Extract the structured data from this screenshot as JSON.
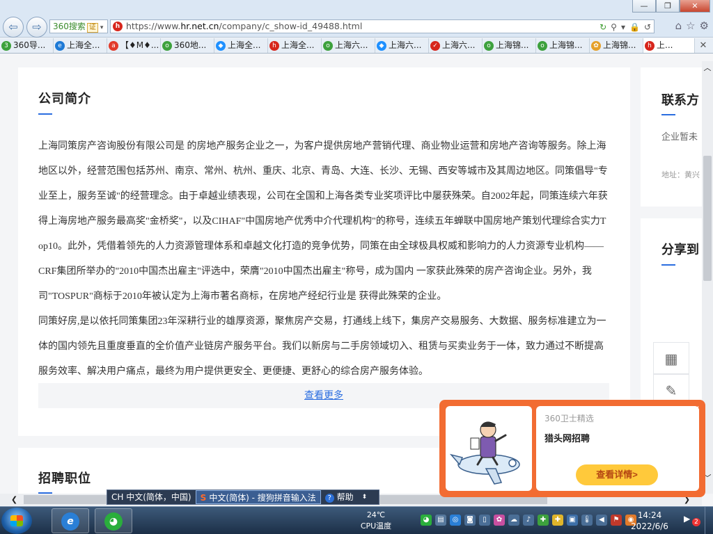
{
  "browser": {
    "back_icon": "back-arrow-icon",
    "forward_icon": "forward-arrow-icon",
    "search_engine": {
      "label": "360搜索",
      "badge": "证"
    },
    "url_prefix": "https://www.",
    "url_host": "hr.net.cn",
    "url_path": "/company/c_show-id_49488.html",
    "addr_tools": [
      "↻",
      "⚲",
      "▾",
      "🔒",
      "↺"
    ],
    "toolbar_icons": [
      "⌂",
      "☆",
      "⚙"
    ],
    "window_buttons": [
      "—",
      "❐",
      "✕"
    ]
  },
  "tabs": [
    {
      "label": "360导...",
      "icon_color": "#3da13d",
      "icon": "3"
    },
    {
      "label": "上海全...",
      "icon_color": "#1e7ad6",
      "icon": "e"
    },
    {
      "label": "【♦M♦...",
      "icon_color": "#e23b2b",
      "icon": "a"
    },
    {
      "label": "360地...",
      "icon_color": "#3da13d",
      "icon": "o"
    },
    {
      "label": "上海全...",
      "icon_color": "#1e90ff",
      "icon": "◆"
    },
    {
      "label": "上海全...",
      "icon_color": "#d7261c",
      "icon": "h"
    },
    {
      "label": "上海六...",
      "icon_color": "#3da13d",
      "icon": "o"
    },
    {
      "label": "上海六...",
      "icon_color": "#1e90ff",
      "icon": "◆"
    },
    {
      "label": "上海六...",
      "icon_color": "#d7261c",
      "icon": "✓"
    },
    {
      "label": "上海锦...",
      "icon_color": "#3da13d",
      "icon": "o"
    },
    {
      "label": "上海锦...",
      "icon_color": "#3da13d",
      "icon": "o"
    },
    {
      "label": "上海锦...",
      "icon_color": "#e5a02a",
      "icon": "✿"
    },
    {
      "label": "上...",
      "icon_color": "#d7261c",
      "icon": "h",
      "active": true
    }
  ],
  "tab_close": "✕",
  "intro": {
    "title": "公司简介",
    "paragraphs": [
      "上海同策房产咨询股份有限公司是 的房地产服务企业之一，为客户提供房地产营销代理、商业物业运营和房地产咨询等服务。除上海地区以外，经营范围包括苏州、南京、常州、杭州、重庆、北京、青岛、大连、长沙、无锡、西安等城市及其周边地区。同策倡导\"专业至上，服务至诚\"的经营理念。由于卓越业绩表现，公司在全国和上海各类专业奖项评比中屡获殊荣。自2002年起，同策连续六年获得上海房地产服务最高奖\"金桥奖\"，以及CIHAF\"中国房地产优秀中介代理机构\"的称号，连续五年蝉联中国房地产策划代理综合实力Top10。此外，凭借着领先的人力资源管理体系和卓越文化打造的竞争优势，同策在由全球极具权威和影响力的人力资源专业机构——CRF集团所举办的\"2010中国杰出雇主\"评选中，荣膺\"2010中国杰出雇主\"称号，成为国内 一家获此殊荣的房产咨询企业。另外，我司\"TOSPUR\"商标于2010年被认定为上海市著名商标，在房地产经纪行业是 获得此殊荣的企业。",
      "同策好房,是以依托同策集团23年深耕行业的雄厚资源，聚焦房产交易，打通线上线下，集房产交易服务、大数据、服务标准建立为一体的国内领先且重度垂直的全价值产业链房产服务平台。我们以新房与二手房领域切入、租赁与买卖业务于一体，致力通过不断提高服务效率、解决用户痛点，最终为用户提供更安全、更便捷、更舒心的综合房产服务体验。"
    ],
    "more_link": "查看更多"
  },
  "jobs": {
    "title": "招聘职位"
  },
  "sidebar": {
    "contact_title": "联系方",
    "contact_text": "企业暂未",
    "address_text": "地址：黄兴",
    "share_title": "分享到",
    "share_icons": [
      "▦",
      "✎"
    ]
  },
  "popup": {
    "tag": "360卫士精选",
    "title": "猎头网招聘",
    "button": "查看详情>",
    "collapse_icon": "﹀",
    "close_icon": "✕"
  },
  "langbar": {
    "lang": "CH 中文(简体，中国)",
    "ime": "中文(简体) - 搜狗拼音输入法",
    "help": "帮助"
  },
  "taskbar": {
    "weather_temp": "24℃",
    "weather_label": "CPU温度",
    "time": "14:24",
    "date": "2022/6/6",
    "notif_count": "2",
    "colors": {
      "taskbar": "#1c2f47",
      "accent": "#2a6de0",
      "popup": "#f26c32"
    }
  }
}
